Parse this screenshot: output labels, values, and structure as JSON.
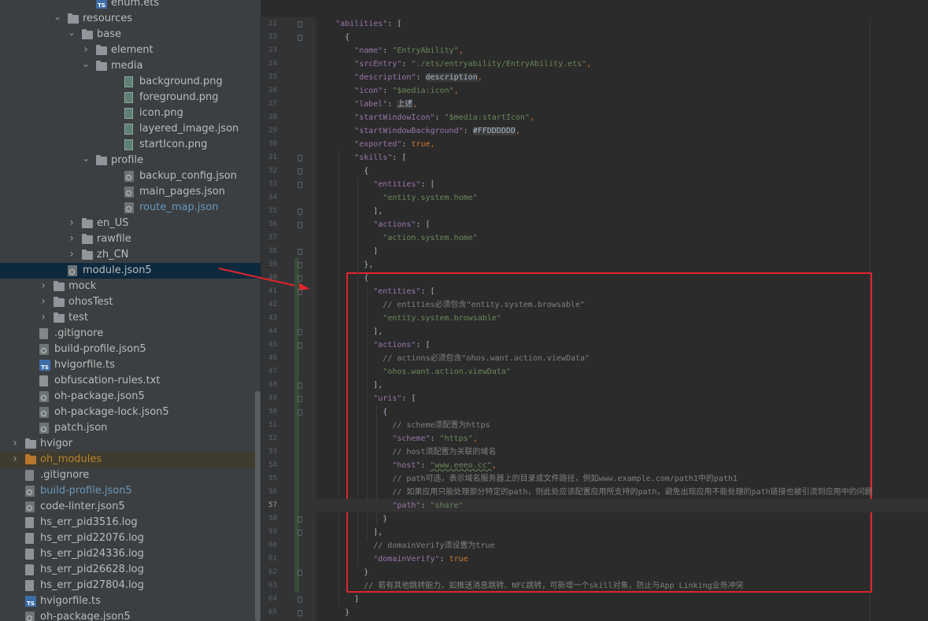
{
  "tree": [
    {
      "id": "enum-ets",
      "depth": 6,
      "type": "ts",
      "name": "enum.ets",
      "partial": true
    },
    {
      "id": "resources",
      "depth": 4,
      "type": "folder",
      "name": "resources",
      "expanded": true
    },
    {
      "id": "base",
      "depth": 5,
      "type": "folder",
      "name": "base",
      "expanded": true
    },
    {
      "id": "element",
      "depth": 6,
      "type": "folder",
      "name": "element",
      "expanded": false
    },
    {
      "id": "media",
      "depth": 6,
      "type": "folder",
      "name": "media",
      "expanded": true
    },
    {
      "id": "background-png",
      "depth": 8,
      "type": "img",
      "name": "background.png"
    },
    {
      "id": "foreground-png",
      "depth": 8,
      "type": "img",
      "name": "foreground.png"
    },
    {
      "id": "icon-png",
      "depth": 8,
      "type": "img",
      "name": "icon.png"
    },
    {
      "id": "layered-image-json",
      "depth": 8,
      "type": "img",
      "name": "layered_image.json"
    },
    {
      "id": "starticon-png",
      "depth": 8,
      "type": "img",
      "name": "startIcon.png"
    },
    {
      "id": "profile",
      "depth": 6,
      "type": "folder",
      "name": "profile",
      "expanded": true
    },
    {
      "id": "backup-config-json",
      "depth": 8,
      "type": "json",
      "name": "backup_config.json"
    },
    {
      "id": "main-pages-json",
      "depth": 8,
      "type": "json",
      "name": "main_pages.json"
    },
    {
      "id": "route-map-json",
      "depth": 8,
      "type": "json",
      "name": "route_map.json",
      "color": "#6897bb"
    },
    {
      "id": "en-us",
      "depth": 5,
      "type": "folder",
      "name": "en_US",
      "expanded": false
    },
    {
      "id": "rawfile",
      "depth": 5,
      "type": "folder",
      "name": "rawfile",
      "expanded": false
    },
    {
      "id": "zh-cn",
      "depth": 5,
      "type": "folder",
      "name": "zh_CN",
      "expanded": false
    },
    {
      "id": "module-json5",
      "depth": 4,
      "type": "json",
      "name": "module.json5",
      "selected": true
    },
    {
      "id": "mock",
      "depth": 3,
      "type": "folder",
      "name": "mock",
      "expanded": false
    },
    {
      "id": "ohostest",
      "depth": 3,
      "type": "folder",
      "name": "ohosTest",
      "expanded": false
    },
    {
      "id": "test",
      "depth": 3,
      "type": "folder",
      "name": "test",
      "expanded": false
    },
    {
      "id": "gitignore-1",
      "depth": 2,
      "type": "git",
      "name": ".gitignore"
    },
    {
      "id": "build-profile-json5-1",
      "depth": 2,
      "type": "json",
      "name": "build-profile.json5"
    },
    {
      "id": "hvigorfile-ts-1",
      "depth": 2,
      "type": "ts",
      "name": "hvigorfile.ts"
    },
    {
      "id": "obfuscation-rules",
      "depth": 2,
      "type": "txt",
      "name": "obfuscation-rules.txt"
    },
    {
      "id": "oh-package-json5-1",
      "depth": 2,
      "type": "json",
      "name": "oh-package.json5"
    },
    {
      "id": "oh-package-lock-json5",
      "depth": 2,
      "type": "json",
      "name": "oh-package-lock.json5"
    },
    {
      "id": "patch-json",
      "depth": 2,
      "type": "json",
      "name": "patch.json"
    },
    {
      "id": "hvigor",
      "depth": 1,
      "type": "folder",
      "name": "hvigor",
      "expanded": false
    },
    {
      "id": "oh-modules",
      "depth": 1,
      "type": "ofolder",
      "name": "oh_modules",
      "expanded": false,
      "color": "#b8862c",
      "ohm": true
    },
    {
      "id": "gitignore-2",
      "depth": 1,
      "type": "git",
      "name": ".gitignore"
    },
    {
      "id": "build-profile-json5-2",
      "depth": 1,
      "type": "json",
      "name": "build-profile.json5",
      "color": "#6897bb"
    },
    {
      "id": "code-linter-json5",
      "depth": 1,
      "type": "json",
      "name": "code-linter.json5"
    },
    {
      "id": "hs-err-3516",
      "depth": 1,
      "type": "log",
      "name": "hs_err_pid3516.log"
    },
    {
      "id": "hs-err-22076",
      "depth": 1,
      "type": "log",
      "name": "hs_err_pid22076.log"
    },
    {
      "id": "hs-err-24336",
      "depth": 1,
      "type": "log",
      "name": "hs_err_pid24336.log"
    },
    {
      "id": "hs-err-26628",
      "depth": 1,
      "type": "log",
      "name": "hs_err_pid26628.log"
    },
    {
      "id": "hs-err-27804",
      "depth": 1,
      "type": "log",
      "name": "hs_err_pid27804.log"
    },
    {
      "id": "hvigorfile-ts-2",
      "depth": 1,
      "type": "ts",
      "name": "hvigorfile.ts"
    },
    {
      "id": "oh-package-json5-2",
      "depth": 1,
      "type": "json",
      "name": "oh-package.json5"
    }
  ],
  "editor": {
    "current_line": 57,
    "lines": [
      {
        "n": 21,
        "t": [
          [
            "    ",
            "p"
          ],
          [
            "\"abilities\"",
            "k"
          ],
          [
            ": [",
            "p"
          ]
        ]
      },
      {
        "n": 22,
        "t": [
          [
            "      {",
            "p"
          ]
        ]
      },
      {
        "n": 23,
        "t": [
          [
            "        ",
            "p"
          ],
          [
            "\"name\"",
            "k"
          ],
          [
            ": ",
            "p"
          ],
          [
            "\"EntryAbility\"",
            "s"
          ],
          [
            ",",
            "b"
          ]
        ]
      },
      {
        "n": 24,
        "t": [
          [
            "        ",
            "p"
          ],
          [
            "\"srcEntry\"",
            "k"
          ],
          [
            ": ",
            "p"
          ],
          [
            "\"./ets/entryability/EntryAbility.ets\"",
            "s"
          ],
          [
            ",",
            "b"
          ]
        ]
      },
      {
        "n": 25,
        "t": [
          [
            "        ",
            "p"
          ],
          [
            "\"description\"",
            "k"
          ],
          [
            ": ",
            "p"
          ],
          [
            "description",
            "hl"
          ],
          [
            ",",
            "b"
          ]
        ]
      },
      {
        "n": 26,
        "t": [
          [
            "        ",
            "p"
          ],
          [
            "\"icon\"",
            "k"
          ],
          [
            ": ",
            "p"
          ],
          [
            "\"$media:icon\"",
            "s"
          ],
          [
            ",",
            "b"
          ]
        ]
      },
      {
        "n": 27,
        "t": [
          [
            "        ",
            "p"
          ],
          [
            "\"label\"",
            "k"
          ],
          [
            ": ",
            "p"
          ],
          [
            "上述",
            "hl"
          ],
          [
            ",",
            "b"
          ]
        ]
      },
      {
        "n": 28,
        "t": [
          [
            "        ",
            "p"
          ],
          [
            "\"startWindowIcon\"",
            "k"
          ],
          [
            ": ",
            "p"
          ],
          [
            "\"$media:startIcon\"",
            "s"
          ],
          [
            ",",
            "b"
          ]
        ]
      },
      {
        "n": 29,
        "t": [
          [
            "        ",
            "p"
          ],
          [
            "\"startWindowBackground\"",
            "k"
          ],
          [
            ": ",
            "p"
          ],
          [
            "#FFDDDDDD",
            "hl"
          ],
          [
            ",",
            "b"
          ]
        ]
      },
      {
        "n": 30,
        "t": [
          [
            "        ",
            "p"
          ],
          [
            "\"exported\"",
            "k"
          ],
          [
            ": ",
            "p"
          ],
          [
            "true",
            "b"
          ],
          [
            ",",
            "b"
          ]
        ]
      },
      {
        "n": 31,
        "t": [
          [
            "        ",
            "p"
          ],
          [
            "\"skills\"",
            "k"
          ],
          [
            ": [",
            "p"
          ]
        ]
      },
      {
        "n": 32,
        "t": [
          [
            "          {",
            "p"
          ]
        ]
      },
      {
        "n": 33,
        "t": [
          [
            "            ",
            "p"
          ],
          [
            "\"entities\"",
            "k"
          ],
          [
            ": [",
            "p"
          ]
        ]
      },
      {
        "n": 34,
        "t": [
          [
            "              ",
            "p"
          ],
          [
            "\"entity.system.home\"",
            "s"
          ]
        ]
      },
      {
        "n": 35,
        "t": [
          [
            "            ],",
            "p"
          ]
        ]
      },
      {
        "n": 36,
        "t": [
          [
            "            ",
            "p"
          ],
          [
            "\"actions\"",
            "k"
          ],
          [
            ": [",
            "p"
          ]
        ]
      },
      {
        "n": 37,
        "t": [
          [
            "              ",
            "p"
          ],
          [
            "\"action.system.home\"",
            "s"
          ]
        ]
      },
      {
        "n": 38,
        "t": [
          [
            "            ]",
            "p"
          ]
        ]
      },
      {
        "n": 39,
        "t": [
          [
            "          },",
            "p"
          ]
        ]
      },
      {
        "n": 40,
        "t": [
          [
            "          {",
            "p"
          ]
        ]
      },
      {
        "n": 41,
        "t": [
          [
            "            ",
            "p"
          ],
          [
            "\"entities\"",
            "k"
          ],
          [
            ": [",
            "p"
          ]
        ]
      },
      {
        "n": 42,
        "t": [
          [
            "              ",
            "p"
          ],
          [
            "// entities必须包含\"entity.system.browsable\"",
            "c"
          ]
        ]
      },
      {
        "n": 43,
        "t": [
          [
            "              ",
            "p"
          ],
          [
            "\"entity.system.browsable\"",
            "s"
          ]
        ]
      },
      {
        "n": 44,
        "t": [
          [
            "            ],",
            "p"
          ]
        ]
      },
      {
        "n": 45,
        "t": [
          [
            "            ",
            "p"
          ],
          [
            "\"actions\"",
            "k"
          ],
          [
            ": [",
            "p"
          ]
        ]
      },
      {
        "n": 46,
        "t": [
          [
            "              ",
            "p"
          ],
          [
            "// actions必须包含\"ohos.want.action.viewData\"",
            "c"
          ]
        ]
      },
      {
        "n": 47,
        "t": [
          [
            "              ",
            "p"
          ],
          [
            "\"ohos.want.action.viewData\"",
            "s"
          ]
        ]
      },
      {
        "n": 48,
        "t": [
          [
            "            ],",
            "p"
          ]
        ]
      },
      {
        "n": 49,
        "t": [
          [
            "            ",
            "p"
          ],
          [
            "\"uris\"",
            "k"
          ],
          [
            ": [",
            "p"
          ]
        ]
      },
      {
        "n": 50,
        "t": [
          [
            "              {",
            "p"
          ]
        ]
      },
      {
        "n": 51,
        "t": [
          [
            "                ",
            "p"
          ],
          [
            "// scheme须配置为https",
            "c"
          ]
        ]
      },
      {
        "n": 52,
        "t": [
          [
            "                ",
            "p"
          ],
          [
            "\"scheme\"",
            "k"
          ],
          [
            ": ",
            "p"
          ],
          [
            "\"https\"",
            "s"
          ],
          [
            ",",
            "b"
          ]
        ]
      },
      {
        "n": 53,
        "t": [
          [
            "                ",
            "p"
          ],
          [
            "// host须配置为关联的域名",
            "c"
          ]
        ]
      },
      {
        "n": 54,
        "t": [
          [
            "                ",
            "p"
          ],
          [
            "\"host\"",
            "k"
          ],
          [
            ": ",
            "p"
          ],
          [
            "\"www.eeeo.cc\"",
            "s"
          ],
          [
            ",",
            "b"
          ]
        ]
      },
      {
        "n": 55,
        "t": [
          [
            "                ",
            "p"
          ],
          [
            "// path可选，表示域名服务器上的目录或文件路径，例如www.example.com/path1中的path1",
            "c"
          ]
        ]
      },
      {
        "n": 56,
        "t": [
          [
            "                ",
            "p"
          ],
          [
            "// 如果应用只能处理部分特定的path，则此处应该配置应用所支持的path，避免出现应用不能处理的path链接也被引流到应用中的问题",
            "c"
          ]
        ]
      },
      {
        "n": 57,
        "t": [
          [
            "                ",
            "p"
          ],
          [
            "\"path\"",
            "k"
          ],
          [
            ": ",
            "p"
          ],
          [
            "\"share\"",
            "s"
          ]
        ]
      },
      {
        "n": 58,
        "t": [
          [
            "              }",
            "p"
          ]
        ]
      },
      {
        "n": 59,
        "t": [
          [
            "            ],",
            "p"
          ]
        ]
      },
      {
        "n": 60,
        "t": [
          [
            "            ",
            "p"
          ],
          [
            "// domainVerify须设置为true",
            "c"
          ]
        ]
      },
      {
        "n": 61,
        "t": [
          [
            "            ",
            "p"
          ],
          [
            "\"domainVerify\"",
            "k"
          ],
          [
            ": ",
            "p"
          ],
          [
            "true",
            "b"
          ]
        ]
      },
      {
        "n": 62,
        "t": [
          [
            "          }",
            "p"
          ]
        ]
      },
      {
        "n": 63,
        "t": [
          [
            "          ",
            "p"
          ],
          [
            "// 若有其他跳转能力，如推送消息跳转、NFC跳转，可新增一个skill对象，防止与App Linking业务冲突",
            "c"
          ]
        ]
      },
      {
        "n": 64,
        "t": [
          [
            "        ]",
            "p"
          ]
        ]
      },
      {
        "n": 65,
        "t": [
          [
            "      }",
            "p"
          ]
        ]
      }
    ]
  },
  "colors": {
    "annotation": "#e0252d"
  }
}
